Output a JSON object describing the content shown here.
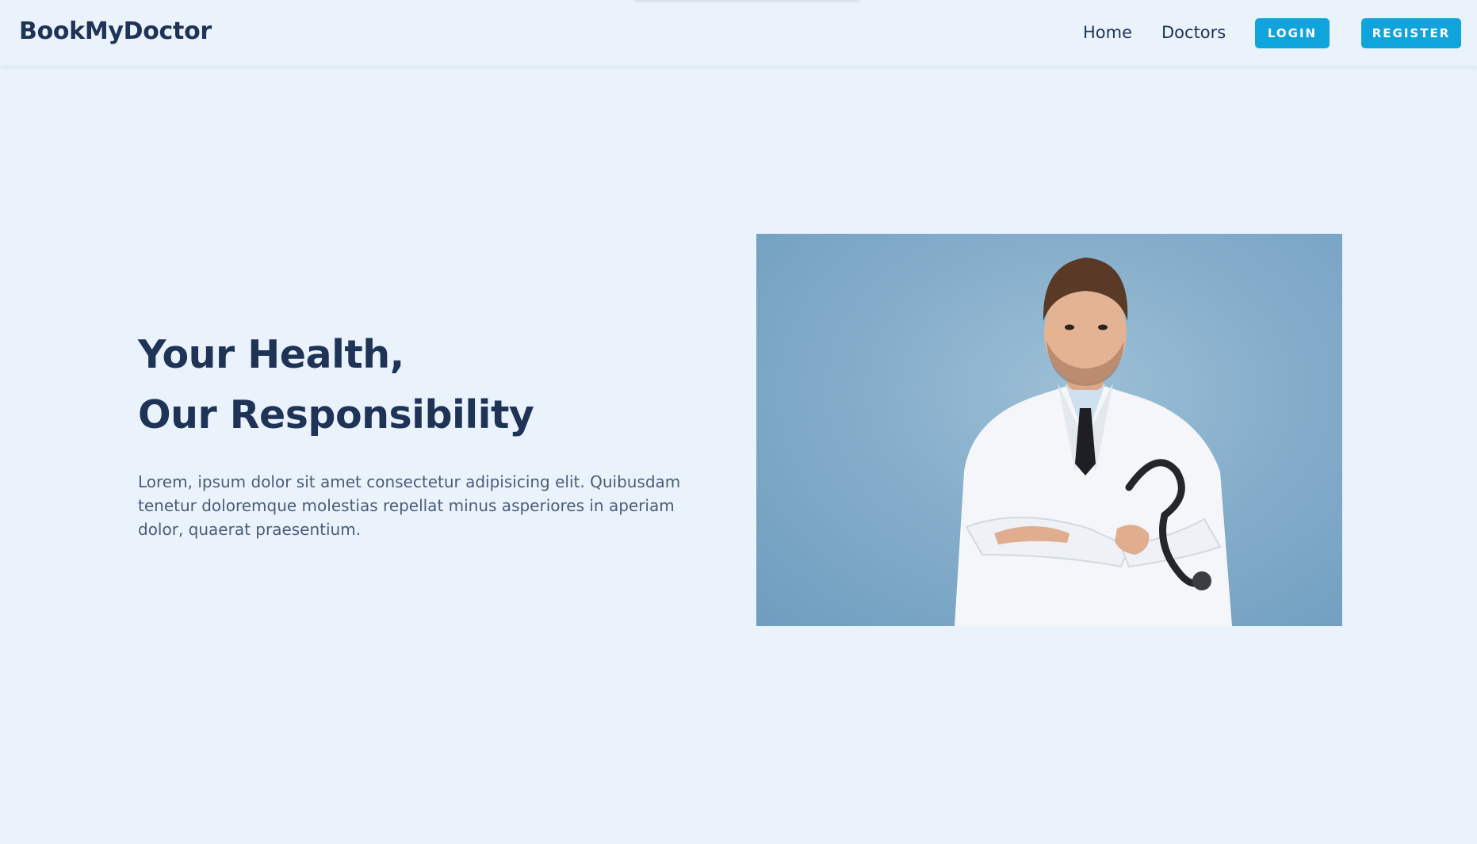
{
  "navbar": {
    "brand": "BookMyDoctor",
    "links": [
      {
        "label": "Home"
      },
      {
        "label": "Doctors"
      }
    ],
    "login_label": "LOGIN",
    "register_label": "REGISTER"
  },
  "hero": {
    "title_line1": "Your Health,",
    "title_line2": "Our Responsibility",
    "description": "Lorem, ipsum dolor sit amet consectetur adipisicing elit. Quibusdam tenetur doloremque molestias repellat minus asperiores in aperiam dolor, quaerat praesentium.",
    "image_subject": "doctor-photo"
  },
  "colors": {
    "background": "#eaf3fc",
    "primary_text": "#1e3355",
    "accent_button": "#0fa4dc",
    "body_text": "#4a5c78"
  }
}
